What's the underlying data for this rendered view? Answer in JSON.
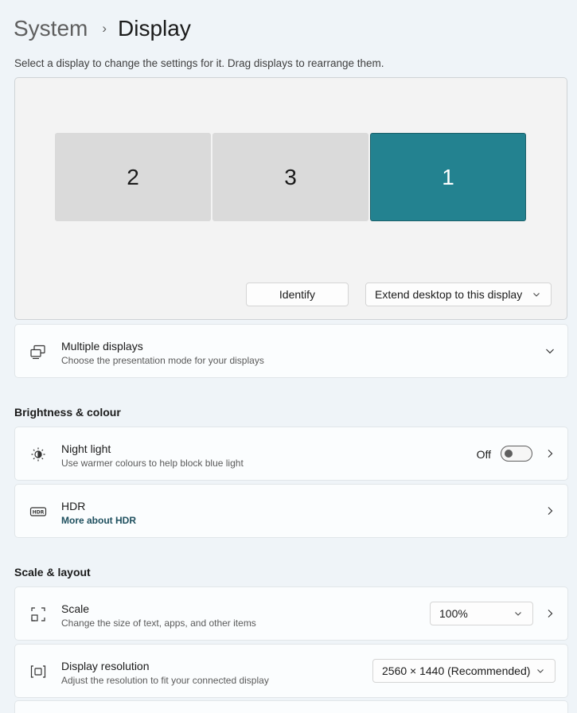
{
  "breadcrumb": {
    "parent": "System",
    "separator": "›",
    "current": "Display"
  },
  "intro": "Select a display to change the settings for it. Drag displays to rearrange them.",
  "displays": [
    {
      "label": "2",
      "selected": false
    },
    {
      "label": "3",
      "selected": false
    },
    {
      "label": "1",
      "selected": true
    }
  ],
  "accent_color": "#238290",
  "arrange_actions": {
    "identify_label": "Identify",
    "mode_value": "Extend desktop to this display"
  },
  "multiple_displays": {
    "icon": "multiple-displays-icon",
    "title": "Multiple displays",
    "description": "Choose the presentation mode for your displays"
  },
  "brightness_section": {
    "heading": "Brightness & colour",
    "night_light": {
      "icon": "night-light-icon",
      "title": "Night light",
      "description": "Use warmer colours to help block blue light",
      "state_label": "Off",
      "enabled": false
    },
    "hdr": {
      "icon": "hdr-icon",
      "title": "HDR",
      "link": "More about HDR"
    }
  },
  "scale_section": {
    "heading": "Scale & layout",
    "scale": {
      "icon": "scale-icon",
      "title": "Scale",
      "description": "Change the size of text, apps, and other items",
      "value": "100%"
    },
    "resolution": {
      "icon": "display-resolution-icon",
      "title": "Display resolution",
      "description": "Adjust the resolution to fit your connected display",
      "value": "2560 × 1440 (Recommended)"
    }
  }
}
